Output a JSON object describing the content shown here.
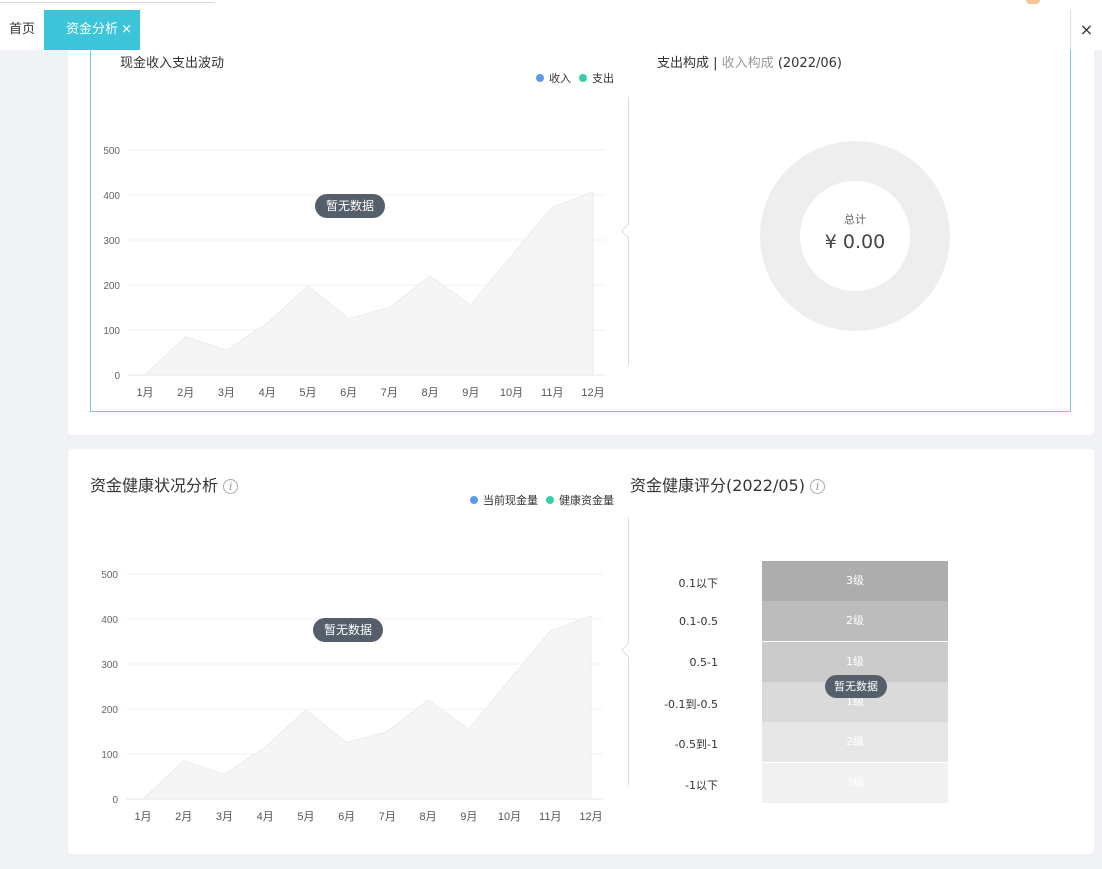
{
  "tabs": {
    "home_label": "首页",
    "active_label": "资金分析",
    "active_close": "×",
    "close_all": "×"
  },
  "cashflow": {
    "title": "现金收入支出波动",
    "legend": [
      {
        "name": "收入",
        "color": "#5b9bea"
      },
      {
        "name": "支出",
        "color": "#36cfa8"
      }
    ],
    "no_data": "暂无数据"
  },
  "composition": {
    "title_active": "支出构成",
    "separator": " | ",
    "title_inactive": "收入构成",
    "period": " (2022/06)",
    "total_label": "总计",
    "total_value": "¥ 0.00"
  },
  "health": {
    "title": "资金健康状况分析",
    "legend": [
      {
        "name": "当前现金量",
        "color": "#5b9bea"
      },
      {
        "name": "健康资金量",
        "color": "#36cfa8"
      }
    ],
    "no_data": "暂无数据"
  },
  "score": {
    "title": "资金健康评分(2022/05)",
    "no_data": "暂无数据",
    "rows": [
      {
        "label": "0.1以下",
        "level": "3级",
        "color": "#adadad"
      },
      {
        "label": "0.1-0.5",
        "level": "2级",
        "color": "#bcbcbc"
      },
      {
        "label": "0.5-1",
        "level": "1级",
        "color": "#cbcbcb"
      },
      {
        "label": "-0.1到-0.5",
        "level": "1级",
        "color": "#dadada"
      },
      {
        "label": "-0.5到-1",
        "level": "2级",
        "color": "#e7e7e7"
      },
      {
        "label": "-1以下",
        "level": "3级",
        "color": "#f1f1f1"
      }
    ]
  },
  "chart_data": [
    {
      "type": "area",
      "categories": [
        "1月",
        "2月",
        "3月",
        "4月",
        "5月",
        "6月",
        "7月",
        "8月",
        "9月",
        "10月",
        "11月",
        "12月"
      ],
      "values": [
        0,
        85,
        55,
        115,
        198,
        125,
        150,
        220,
        155,
        265,
        373,
        407
      ],
      "yticks": [
        0,
        100,
        200,
        300,
        400,
        500
      ],
      "ylim": [
        0,
        500
      ],
      "grid": true,
      "color": "#f5f5f5"
    },
    {
      "type": "area",
      "categories": [
        "1月",
        "2月",
        "3月",
        "4月",
        "5月",
        "6月",
        "7月",
        "8月",
        "9月",
        "10月",
        "11月",
        "12月"
      ],
      "values": [
        0,
        85,
        55,
        115,
        198,
        125,
        150,
        220,
        155,
        265,
        373,
        407
      ],
      "yticks": [
        0,
        100,
        200,
        300,
        400,
        500
      ],
      "ylim": [
        0,
        500
      ],
      "grid": true,
      "color": "#f5f5f5"
    }
  ]
}
